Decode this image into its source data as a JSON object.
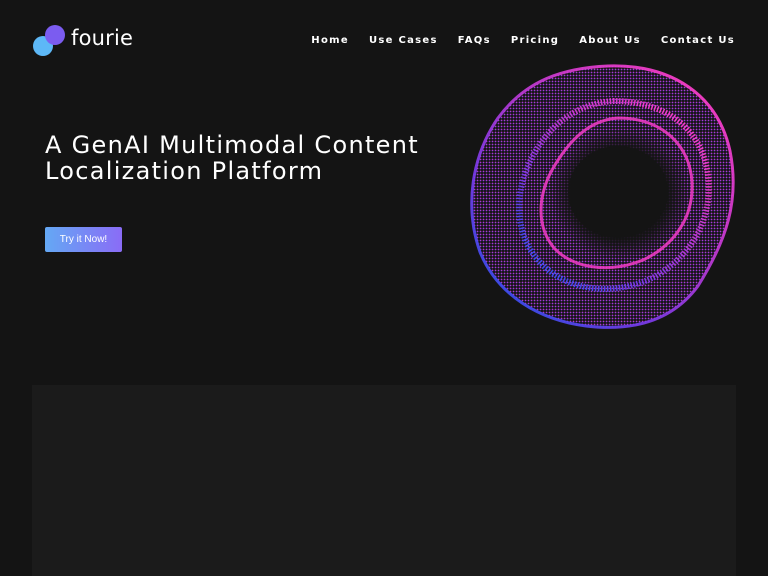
{
  "brand": {
    "name": "fourie",
    "colors": {
      "dot_primary": "#5db8f7",
      "dot_secondary": "#7b5cf0"
    }
  },
  "nav": {
    "items": [
      {
        "label": "Home"
      },
      {
        "label": "Use Cases"
      },
      {
        "label": "FAQs"
      },
      {
        "label": "Pricing"
      },
      {
        "label": "About Us"
      },
      {
        "label": "Contact Us"
      }
    ]
  },
  "hero": {
    "title_line1": "A GenAI Multimodal Content",
    "title_line2": "Localization Platform",
    "cta_label": "Try it Now!",
    "cta_gradient": [
      "#64a8f4",
      "#8a6cf6"
    ],
    "orb_colors": [
      "#ff3fd0",
      "#c23ad8",
      "#7a3cf0",
      "#3d4ff5"
    ]
  },
  "colors": {
    "background": "#141414",
    "panel": "#1b1b1b"
  }
}
